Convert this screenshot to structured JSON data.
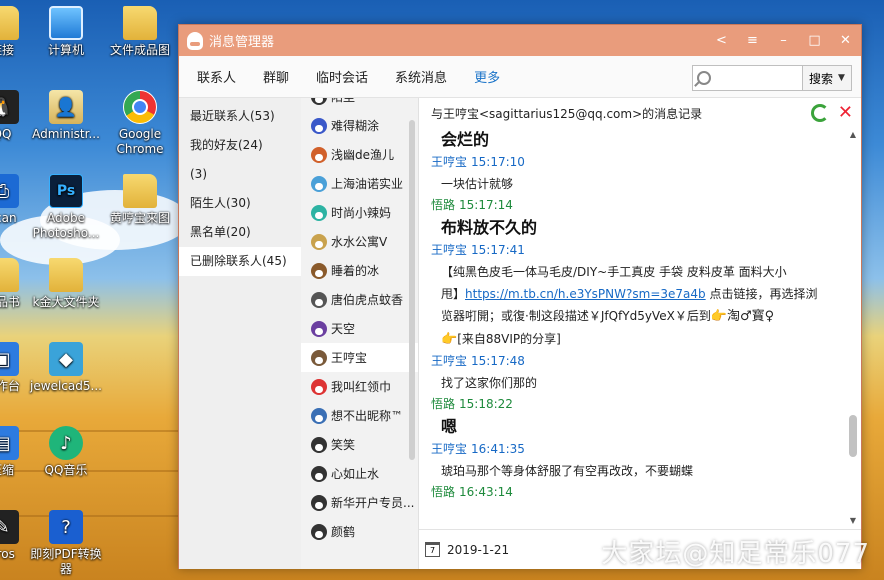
{
  "desktop": {
    "icons": [
      {
        "label": "链接",
        "icon": "folder-icon"
      },
      {
        "label": "计算机",
        "icon": "computer-icon"
      },
      {
        "label": "文件成品图",
        "icon": "folder-icon"
      },
      {
        "label": "QQ",
        "icon": "qq-icon"
      },
      {
        "label": "Administr...",
        "icon": "user-folder-icon"
      },
      {
        "label": "Google Chrome",
        "icon": "chrome-icon"
      },
      {
        "label": "Scan",
        "icon": "scan-icon"
      },
      {
        "label": "Adobe Photosho...",
        "icon": "photoshop-icon"
      },
      {
        "label": "黄哼宝来图",
        "icon": "folder-icon"
      },
      {
        "label": "产品书",
        "icon": "folder-icon"
      },
      {
        "label": "k金大文件夹",
        "icon": "folder-icon"
      },
      {
        "label": "工作台",
        "icon": "app-icon"
      },
      {
        "label": "jewelcad5...",
        "icon": "jewelcad-icon"
      },
      {
        "label": "压缩",
        "icon": "zip-icon"
      },
      {
        "label": "QQ音乐",
        "icon": "qq-music-icon"
      },
      {
        "label": "eros",
        "icon": "heros-icon"
      },
      {
        "label": "即刻PDF转换器",
        "icon": "pdf-icon"
      }
    ]
  },
  "window": {
    "title": "消息管理器",
    "controls": {
      "back": "<",
      "menu": "≡",
      "minimize": "–",
      "maximize": "□",
      "close": "✕"
    }
  },
  "toolbar": {
    "tabs": [
      "联系人",
      "群聊",
      "临时会话",
      "系统消息",
      "更多"
    ],
    "active_tab": "更多",
    "search": {
      "value": "",
      "button": "搜索"
    }
  },
  "groups": [
    "最近联系人(53)",
    "我的好友(24)",
    "(3)",
    "陌生人(30)",
    "黑名单(20)",
    "已删除联系人(45)"
  ],
  "selected_group": "已删除联系人(45)",
  "contacts": [
    "陌尘",
    "难得糊涂",
    "浅幽de渔儿",
    "上海油诺实业",
    "时尚小辣妈",
    "水水公寓V",
    "睡着的冰",
    "唐伯虎点蚊香",
    "天空",
    "王哼宝",
    "我叫红领巾",
    "想不出昵称™",
    "笑笑",
    "心如止水",
    "新华开户专员...",
    "颜鹤"
  ],
  "selected_contact": "王哼宝",
  "chat": {
    "header": "与王哼宝<sagittarius125@qq.com>的消息记录",
    "messages": [
      {
        "type": "big",
        "text": "会烂的"
      },
      {
        "type": "meta",
        "sender": "王哼宝",
        "time": "15:17:10",
        "color": "#1769c5"
      },
      {
        "type": "text",
        "text": "一块估计就够"
      },
      {
        "type": "meta",
        "sender": "悟路",
        "time": "15:17:14",
        "color": "#1e8a3c"
      },
      {
        "type": "big",
        "text": "布料放不久的"
      },
      {
        "type": "meta",
        "sender": "王哼宝",
        "time": "15:17:41",
        "color": "#1769c5"
      },
      {
        "type": "taobao",
        "line1": "【纯黑色皮毛一体马毛皮/DIY~手工真皮 手袋 皮料皮革 面料大小",
        "line2_pre": "甩】",
        "link": "https://m.tb.cn/h.e3YsPNW?sm=3e7a4b",
        "line2_post": " 点击链接，再选择浏",
        "line3": "览器咑開；或復·制这段描述￥JfQfYd5yVeX￥后到",
        "line3_emo": "👉淘♂寳♀",
        "line4_emo": "👉",
        "line4": "[来自88VIP的分享]"
      },
      {
        "type": "meta",
        "sender": "王哼宝",
        "time": "15:17:48",
        "color": "#1769c5"
      },
      {
        "type": "text",
        "text": "找了这家你们那的"
      },
      {
        "type": "meta",
        "sender": "悟路",
        "time": "15:18:22",
        "color": "#1e8a3c"
      },
      {
        "type": "big",
        "text": "嗯"
      },
      {
        "type": "meta",
        "sender": "王哼宝",
        "time": "16:41:35",
        "color": "#1769c5"
      },
      {
        "type": "text",
        "text": "琥珀马那个等身体舒服了有空再改改，不要蝴蝶"
      },
      {
        "type": "meta",
        "sender": "悟路",
        "time": "16:43:14",
        "color": "#1e8a3c"
      }
    ],
    "footer_date": "2019-1-21"
  },
  "watermark": "大家坛@知足常乐077"
}
